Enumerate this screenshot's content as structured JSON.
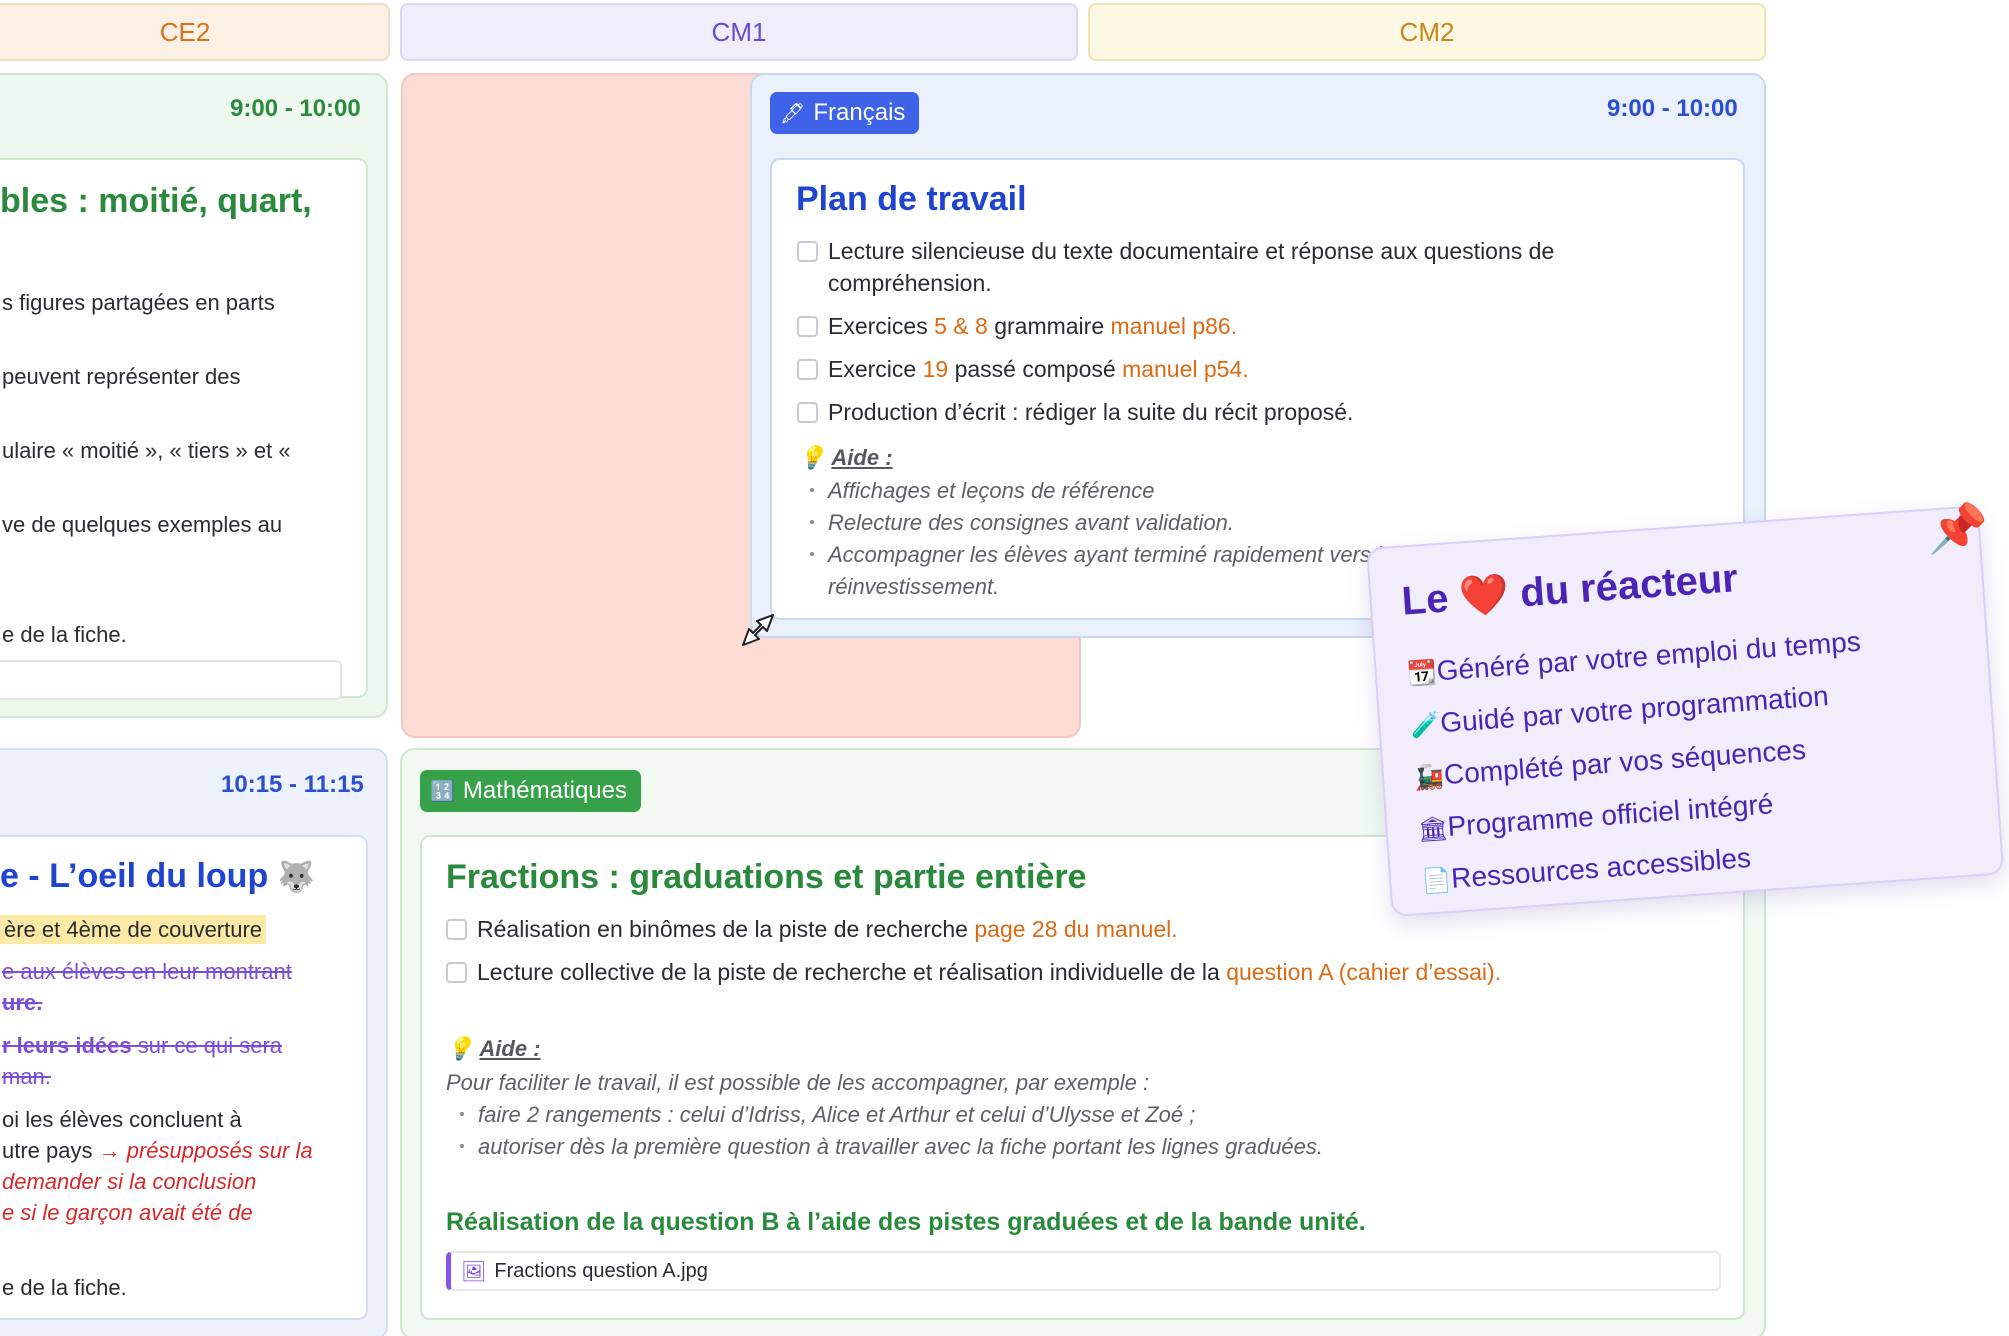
{
  "columns": {
    "ce2": "CE2",
    "cm1": "CM1",
    "cm2": "CM2"
  },
  "ce2_top": {
    "time": "9:00 - 10:00",
    "title": "bles : moitié, quart,",
    "lines": [
      "s figures partagées en parts",
      "peuvent représenter des",
      "ulaire « moitié », « tiers » et «",
      "ve de quelques exemples au",
      "e de la fiche."
    ]
  },
  "ce2_bottom": {
    "time": "10:15 - 11:15",
    "title": "e - L’oeil du loup",
    "title_icon": "wolf-icon",
    "highlight": "ère et 4ème de couverture",
    "strike1a": "e aux élèves en leur montrant",
    "strike1b": "ure.",
    "strike2_bold": "r leurs idées",
    "strike2_rest": " sur ce qui sera",
    "strike2b": "man.",
    "line1": "oi les élèves concluent à",
    "line2_plain": "utre pays ",
    "line2_red": "→ présupposés sur la",
    "red2": "demander si la conclusion",
    "red3": "e si le garçon avait été de",
    "last": "e de la fiche."
  },
  "francais": {
    "badge": "Français",
    "badge_icon": "pen-icon",
    "time": "9:00 - 10:00",
    "title": "Plan de travail",
    "task1a": "Lecture silencieuse du texte documentaire et réponse aux questions de",
    "task1b": "compréhension.",
    "task2_pre": "Exercices ",
    "task2_hl1": "5 & 8",
    "task2_mid": " grammaire ",
    "task2_hl2": "manuel p86.",
    "task3_pre": "Exercice ",
    "task3_hl1": "19",
    "task3_mid": " passé composé ",
    "task3_hl2": "manuel p54.",
    "task4": "Production d’écrit : rédiger la suite du récit proposé.",
    "aide_title": "Aide :",
    "aide_items": [
      "Affichages et leçons de référence",
      "Relecture des consignes avant validation.",
      "Accompagner les élèves ayant terminé rapidement vers l’activité de"
    ],
    "aide_cont": "réinvestissement."
  },
  "maths": {
    "badge": "Mathématiques",
    "badge_icon": "numbers-icon",
    "title": "Fractions : graduations et partie entière",
    "task1_pre": "Réalisation en binômes de la piste de recherche ",
    "task1_hl": "page 28 du manuel.",
    "task2_pre": "Lecture collective de la piste de recherche et réalisation individuelle de la ",
    "task2_hl": "question A (cahier d’essai).",
    "aide_title": "Aide :",
    "aide_intro": "Pour faciliter le travail, il est possible de les accompagner, par exemple :",
    "aide_items": [
      "faire 2 rangements : celui d’Idriss, Alice et Arthur et celui d’Ulysse et Zoé ;",
      "autoriser dès la première question à travailler avec la fiche portant les lignes graduées."
    ],
    "subtitle": "Réalisation de la question B à l’aide des pistes graduées et de la bande unité.",
    "file": "Fractions question A.jpg"
  },
  "note": {
    "title_pre": "Le",
    "title_post": "du réacteur",
    "items": [
      {
        "icon": "calendar-icon",
        "label": "Généré par votre emploi du temps"
      },
      {
        "icon": "test-tube-icon",
        "label": "Guidé par votre programmation"
      },
      {
        "icon": "train-icon",
        "label": "Complété par vos séquences"
      },
      {
        "icon": "bank-icon",
        "label": "Programme officiel intégré"
      },
      {
        "icon": "document-icon",
        "label": "Ressources accessibles"
      }
    ]
  },
  "colors": {
    "accent_blue": "#2a4fd4",
    "accent_green": "#2a8a3c",
    "highlight_orange": "#dd6a12",
    "note_purple": "#4a25b4"
  }
}
